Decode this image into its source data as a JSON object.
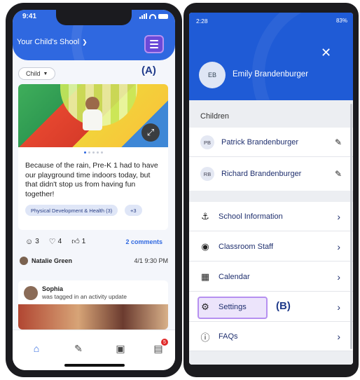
{
  "phone_a": {
    "status_time": "9:41",
    "school_title": "Your Child's Shool",
    "child_filter": "Child",
    "annotation_a": "(A)",
    "post": {
      "text": "Because of the rain, Pre-K 1 had to have our playground time indoors today, but that didn't stop us from having fun together!",
      "tag_primary": "Physical Development & Health (3)",
      "tag_more": "+3",
      "reactions": {
        "smile": "3",
        "heart": "4",
        "thumbs": "1"
      },
      "comments": "2 comments",
      "author": "Natalie Green",
      "date": "4/1 9:30 PM"
    },
    "post2": {
      "name": "Sophia",
      "subtitle": "was tagged in an activity update"
    },
    "tabbar": {
      "messages_badge": "5"
    },
    "colors": {
      "brand": "#2f68e0",
      "highlight": "#b690f0"
    }
  },
  "phone_b": {
    "status_time": "2:28",
    "status_battery": "83%",
    "user_initials": "EB",
    "user_name": "Emily Brandenburger",
    "children_title": "Children",
    "children": [
      {
        "initials": "PB",
        "name": "Patrick Brandenburger"
      },
      {
        "initials": "RB",
        "name": "Richard Brandenburger"
      }
    ],
    "menu": [
      {
        "label": "School Information",
        "icon": "school-icon"
      },
      {
        "label": "Classroom Staff",
        "icon": "apple-icon"
      },
      {
        "label": "Calendar",
        "icon": "calendar-icon"
      },
      {
        "label": "Settings",
        "icon": "gear-icon"
      },
      {
        "label": "FAQs",
        "icon": "question-icon"
      }
    ],
    "annotation_b": "(B)"
  }
}
